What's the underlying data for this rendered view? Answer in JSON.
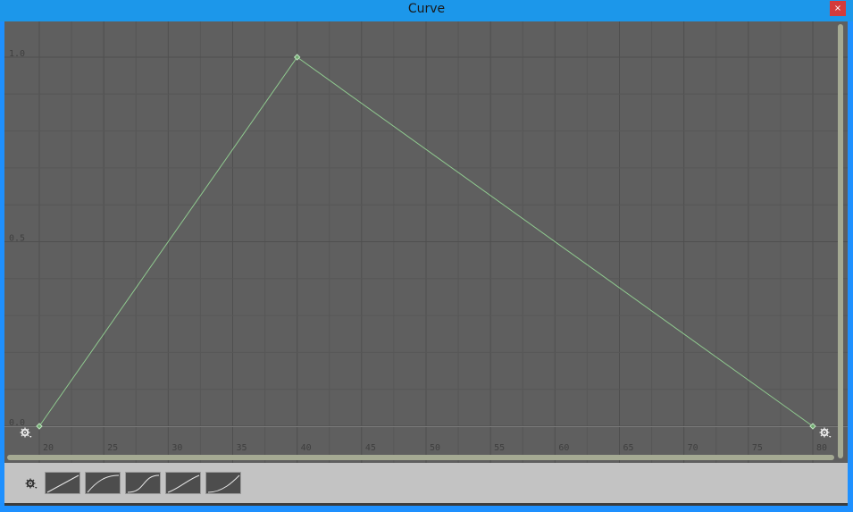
{
  "window": {
    "title": "Curve",
    "close_label": "×"
  },
  "colors": {
    "accent": "#1c97ea",
    "graph_bg": "#5f5f5f",
    "curve": "#8fc98f",
    "close": "#d33b3b"
  },
  "icons": {
    "settings": "gear-icon"
  },
  "chart_data": {
    "type": "line",
    "xlim": [
      20,
      80
    ],
    "ylim": [
      0,
      1
    ],
    "xticks": [
      "20",
      "25",
      "30",
      "35",
      "40",
      "45",
      "50",
      "55",
      "60",
      "65",
      "70",
      "75",
      "80"
    ],
    "yticks": [
      "0.0",
      "0.5",
      "1.0"
    ],
    "keyframes": [
      {
        "x": 20,
        "y": 0.0
      },
      {
        "x": 40,
        "y": 1.0
      },
      {
        "x": 80,
        "y": 0.0
      }
    ],
    "grid": true
  },
  "presets": [
    {
      "name": "preset-linear"
    },
    {
      "name": "preset-ease-out"
    },
    {
      "name": "preset-ease-in-out"
    },
    {
      "name": "preset-linear-2"
    },
    {
      "name": "preset-ease-in"
    }
  ]
}
